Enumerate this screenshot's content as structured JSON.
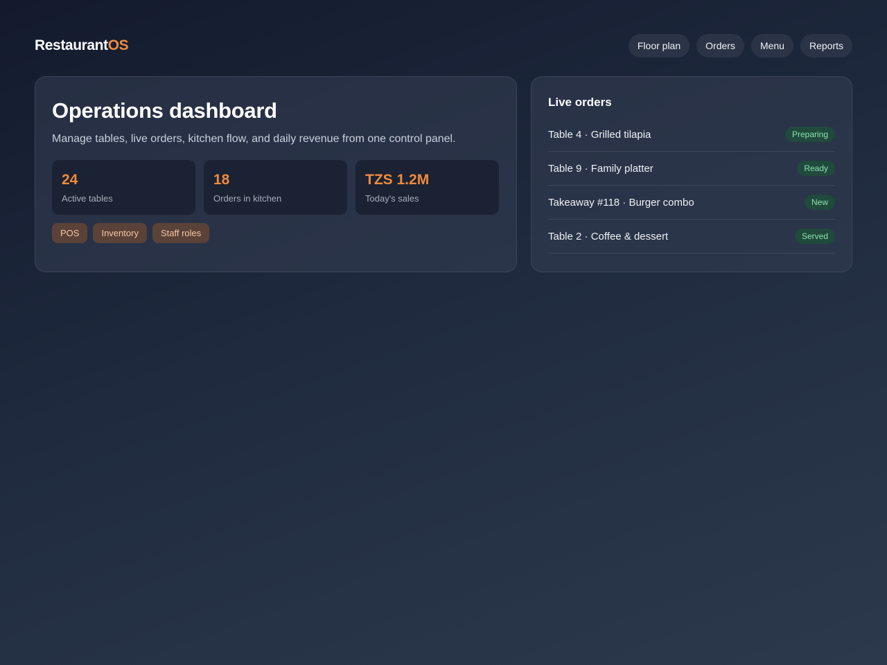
{
  "brand": {
    "name": "Restaurant",
    "accent": "OS"
  },
  "nav": [
    "Floor plan",
    "Orders",
    "Menu",
    "Reports"
  ],
  "dashboard": {
    "title": "Operations dashboard",
    "subtitle": "Manage tables, live orders, kitchen flow, and daily revenue from one control panel.",
    "stats": [
      {
        "value": "24",
        "label": "Active tables"
      },
      {
        "value": "18",
        "label": "Orders in kitchen"
      },
      {
        "value": "TZS 1.2M",
        "label": "Today's sales"
      }
    ],
    "tags": [
      "POS",
      "Inventory",
      "Staff roles"
    ]
  },
  "live_orders": {
    "title": "Live orders",
    "items": [
      {
        "name": "Table 4 · Grilled tilapia",
        "status": "Preparing"
      },
      {
        "name": "Table 9 · Family platter",
        "status": "Ready"
      },
      {
        "name": "Takeaway #118 · Burger combo",
        "status": "New"
      },
      {
        "name": "Table 2 · Coffee & dessert",
        "status": "Served"
      }
    ]
  },
  "colors": {
    "accent": "#f08a3c",
    "badge_bg": "#1f4a3c",
    "badge_text": "#8ee0b0",
    "tag_bg": "#5a4238",
    "tag_text": "#f6c8a4"
  }
}
